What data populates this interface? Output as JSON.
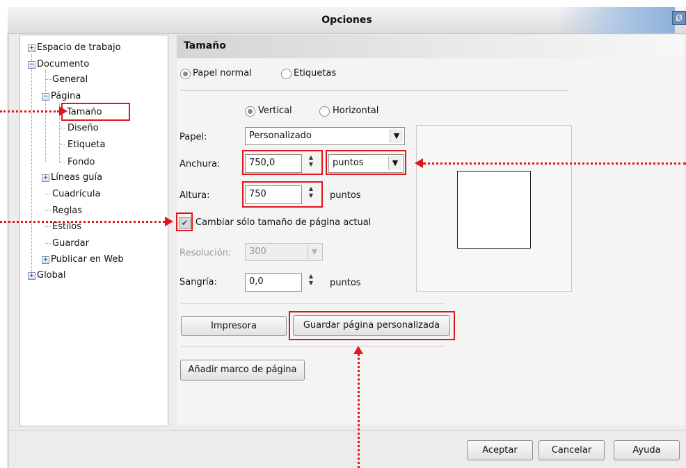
{
  "window": {
    "title": "Opciones",
    "close_glyph": "Ø"
  },
  "tree": [
    {
      "label": "Espacio de trabajo",
      "expander": "+"
    },
    {
      "label": "Documento",
      "expander": "−"
    },
    {
      "label": "General"
    },
    {
      "label": "Página",
      "expander": "−"
    },
    {
      "label": "Tamaño",
      "selected": true
    },
    {
      "label": "Diseño"
    },
    {
      "label": "Etiqueta"
    },
    {
      "label": "Fondo"
    },
    {
      "label": "Líneas guía",
      "expander": "+"
    },
    {
      "label": "Cuadrícula"
    },
    {
      "label": "Reglas"
    },
    {
      "label": "Estilos"
    },
    {
      "label": "Guardar"
    },
    {
      "label": "Publicar en Web",
      "expander": "+"
    },
    {
      "label": "Global",
      "expander": "+"
    }
  ],
  "panel": {
    "header": "Tamaño",
    "paper_type": {
      "normal": "Papel normal",
      "labels": "Etiquetas",
      "selected": "normal"
    },
    "orientation": {
      "vertical": "Vertical",
      "horizontal": "Horizontal",
      "selected": "vertical"
    },
    "paper": {
      "label": "Papel:",
      "value": "Personalizado"
    },
    "width": {
      "label": "Anchura:",
      "value": "750,0",
      "unit": "puntos"
    },
    "height": {
      "label": "Altura:",
      "value": "750",
      "unit": "puntos"
    },
    "current_only": {
      "label": "Cambiar sólo tamaño de página actual",
      "checked": true
    },
    "resolution": {
      "label": "Resolución:",
      "value": "300"
    },
    "bleed": {
      "label": "Sangría:",
      "value": "0,0",
      "unit": "puntos"
    },
    "printer_button": "Impresora",
    "save_custom_button": "Guardar página personalizada",
    "add_frame_button": "Añadir marco de página"
  },
  "footer": {
    "ok": "Aceptar",
    "cancel": "Cancelar",
    "help": "Ayuda"
  },
  "colors": {
    "annotation": "#e0161b",
    "title_accent": "#8fb0d8"
  }
}
